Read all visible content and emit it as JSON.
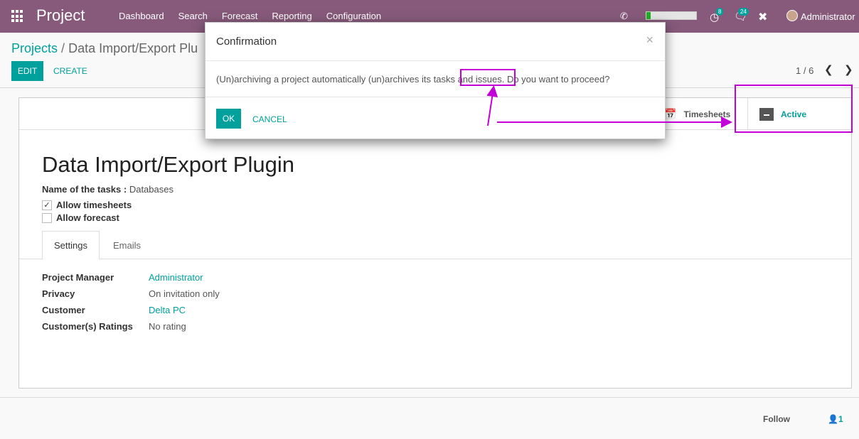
{
  "navbar": {
    "brand": "Project",
    "menu": [
      "Dashboard",
      "Search",
      "Forecast",
      "Reporting",
      "Configuration"
    ],
    "activity_count": "8",
    "message_count": "24",
    "user": "Administrator",
    "progress_fraction": 0.08
  },
  "control_panel": {
    "breadcrumb_root": "Projects",
    "breadcrumb_sep": "/",
    "breadcrumb_current": "Data Import/Export Plu",
    "edit_label": "EDIT",
    "create_label": "CREATE",
    "pager": "1 / 6"
  },
  "form": {
    "stat_timesheets": "Timesheets",
    "stat_active": "Active",
    "title": "Data Import/Export Plugin",
    "tasks_label": "Name of the tasks :",
    "tasks_value": "Databases",
    "allow_timesheets": "Allow timesheets",
    "allow_forecast": "Allow forecast",
    "tabs": [
      "Settings",
      "Emails"
    ],
    "fields": [
      {
        "label": "Project Manager",
        "value": "Administrator"
      },
      {
        "label": "Privacy",
        "value": "On invitation only"
      },
      {
        "label": "Customer",
        "value": "Delta PC"
      },
      {
        "label": "Customer(s) Ratings",
        "value": "No rating"
      }
    ]
  },
  "chatter": {
    "follow": "Follow",
    "followers": "1"
  },
  "modal": {
    "title": "Confirmation",
    "close": "×",
    "body": "(Un)archiving a project automatically (un)archives its tasks and issues. Do you want to proceed?",
    "ok_label": "OK",
    "cancel_label": "CANCEL"
  },
  "colors": {
    "navbar": "#875a7b",
    "accent": "#00a09d",
    "annotation": "#c400d8"
  }
}
